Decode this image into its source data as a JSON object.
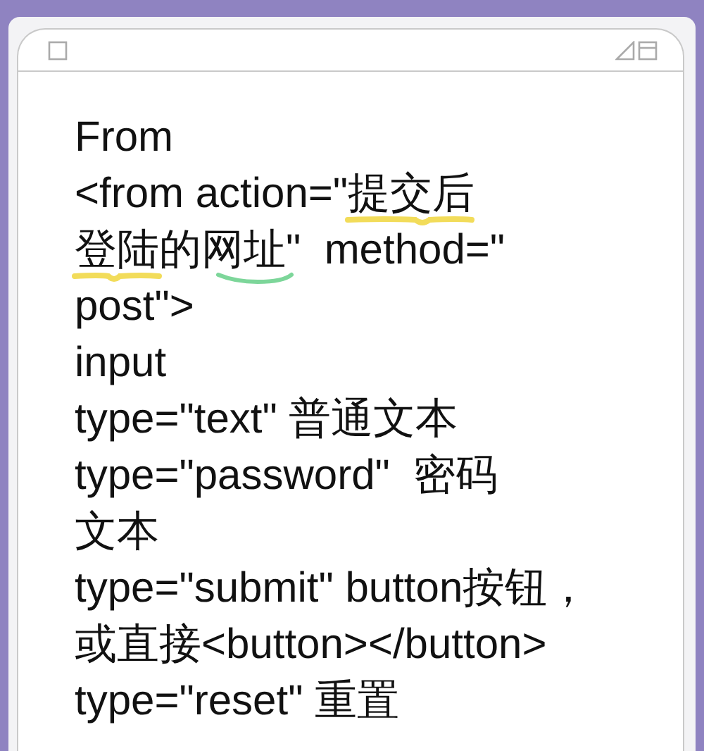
{
  "note": {
    "lines": [
      "From",
      "<from action=\"提交后",
      "登陆的网址\"  method=\"",
      "post\">",
      "input",
      "type=\"text\" 普通文本",
      "type=\"password\"  密码",
      "文本",
      "type=\"submit\" button按钮，",
      "或直接<button></button>",
      "type=\"reset\" 重置"
    ]
  }
}
